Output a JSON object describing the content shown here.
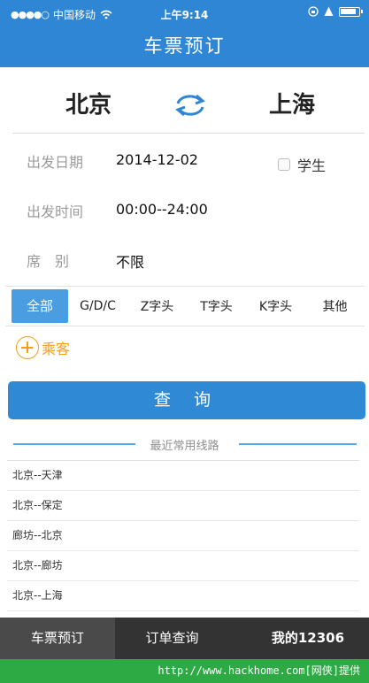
{
  "status_bar": {
    "carrier": "中国移动",
    "time": "上午9:14",
    "signal_dots": "●●●●○"
  },
  "nav": {
    "title": "车票预订"
  },
  "route": {
    "from": "北京",
    "to": "上海"
  },
  "form": {
    "date_label": "出发日期",
    "date_value": "2014-12-02",
    "time_label": "出发时间",
    "time_value": "00:00--24:00",
    "seat_label": "席　别",
    "seat_value": "不限",
    "student_label": "学生"
  },
  "filters": [
    "全部",
    "G/D/C",
    "Z字头",
    "T字头",
    "K字头",
    "其他"
  ],
  "passenger_label": "乘客",
  "query_button": "查 询",
  "recent": {
    "title": "最近常用线路",
    "routes": [
      "北京--天津",
      "北京--保定",
      "廊坊--北京",
      "北京--廊坊",
      "北京--上海"
    ]
  },
  "tabbar": {
    "tabs": [
      "车票预订",
      "订单查询",
      "我的12306"
    ]
  },
  "watermark": "http://www.hackhome.com[网侠]提供",
  "colors": {
    "primary": "#2f86d4",
    "accent": "#f0a01e",
    "tabbar": "#333333",
    "watermark": "#2eaa45"
  }
}
